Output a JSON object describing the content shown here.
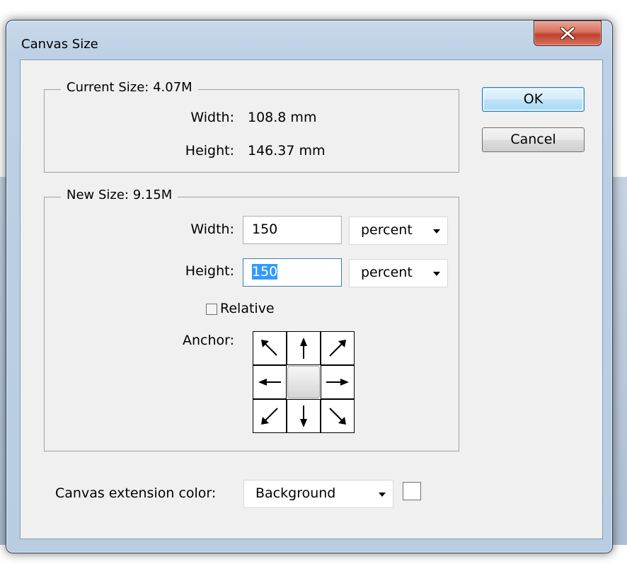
{
  "window": {
    "title": "Canvas Size",
    "close_icon": "close-x-icon"
  },
  "current_size": {
    "legend": "Current Size: 4.07M",
    "width_label": "Width:",
    "width_value": "108.8 mm",
    "height_label": "Height:",
    "height_value": "146.37 mm"
  },
  "new_size": {
    "legend": "New Size: 9.15M",
    "width_label": "Width:",
    "width_value": "150",
    "width_unit": "percent",
    "height_label": "Height:",
    "height_value": "150",
    "height_unit": "percent",
    "relative_label": "Relative",
    "relative_checked": false,
    "anchor_label": "Anchor:",
    "anchor_cells": [
      "arrow-up-left-icon",
      "arrow-up-icon",
      "arrow-up-right-icon",
      "arrow-left-icon",
      "anchor-center",
      "arrow-right-icon",
      "arrow-down-left-icon",
      "arrow-down-icon",
      "arrow-down-right-icon"
    ]
  },
  "extension": {
    "label": "Canvas extension color:",
    "value": "Background",
    "swatch_color": "#ffffff"
  },
  "buttons": {
    "ok": "OK",
    "cancel": "Cancel"
  }
}
